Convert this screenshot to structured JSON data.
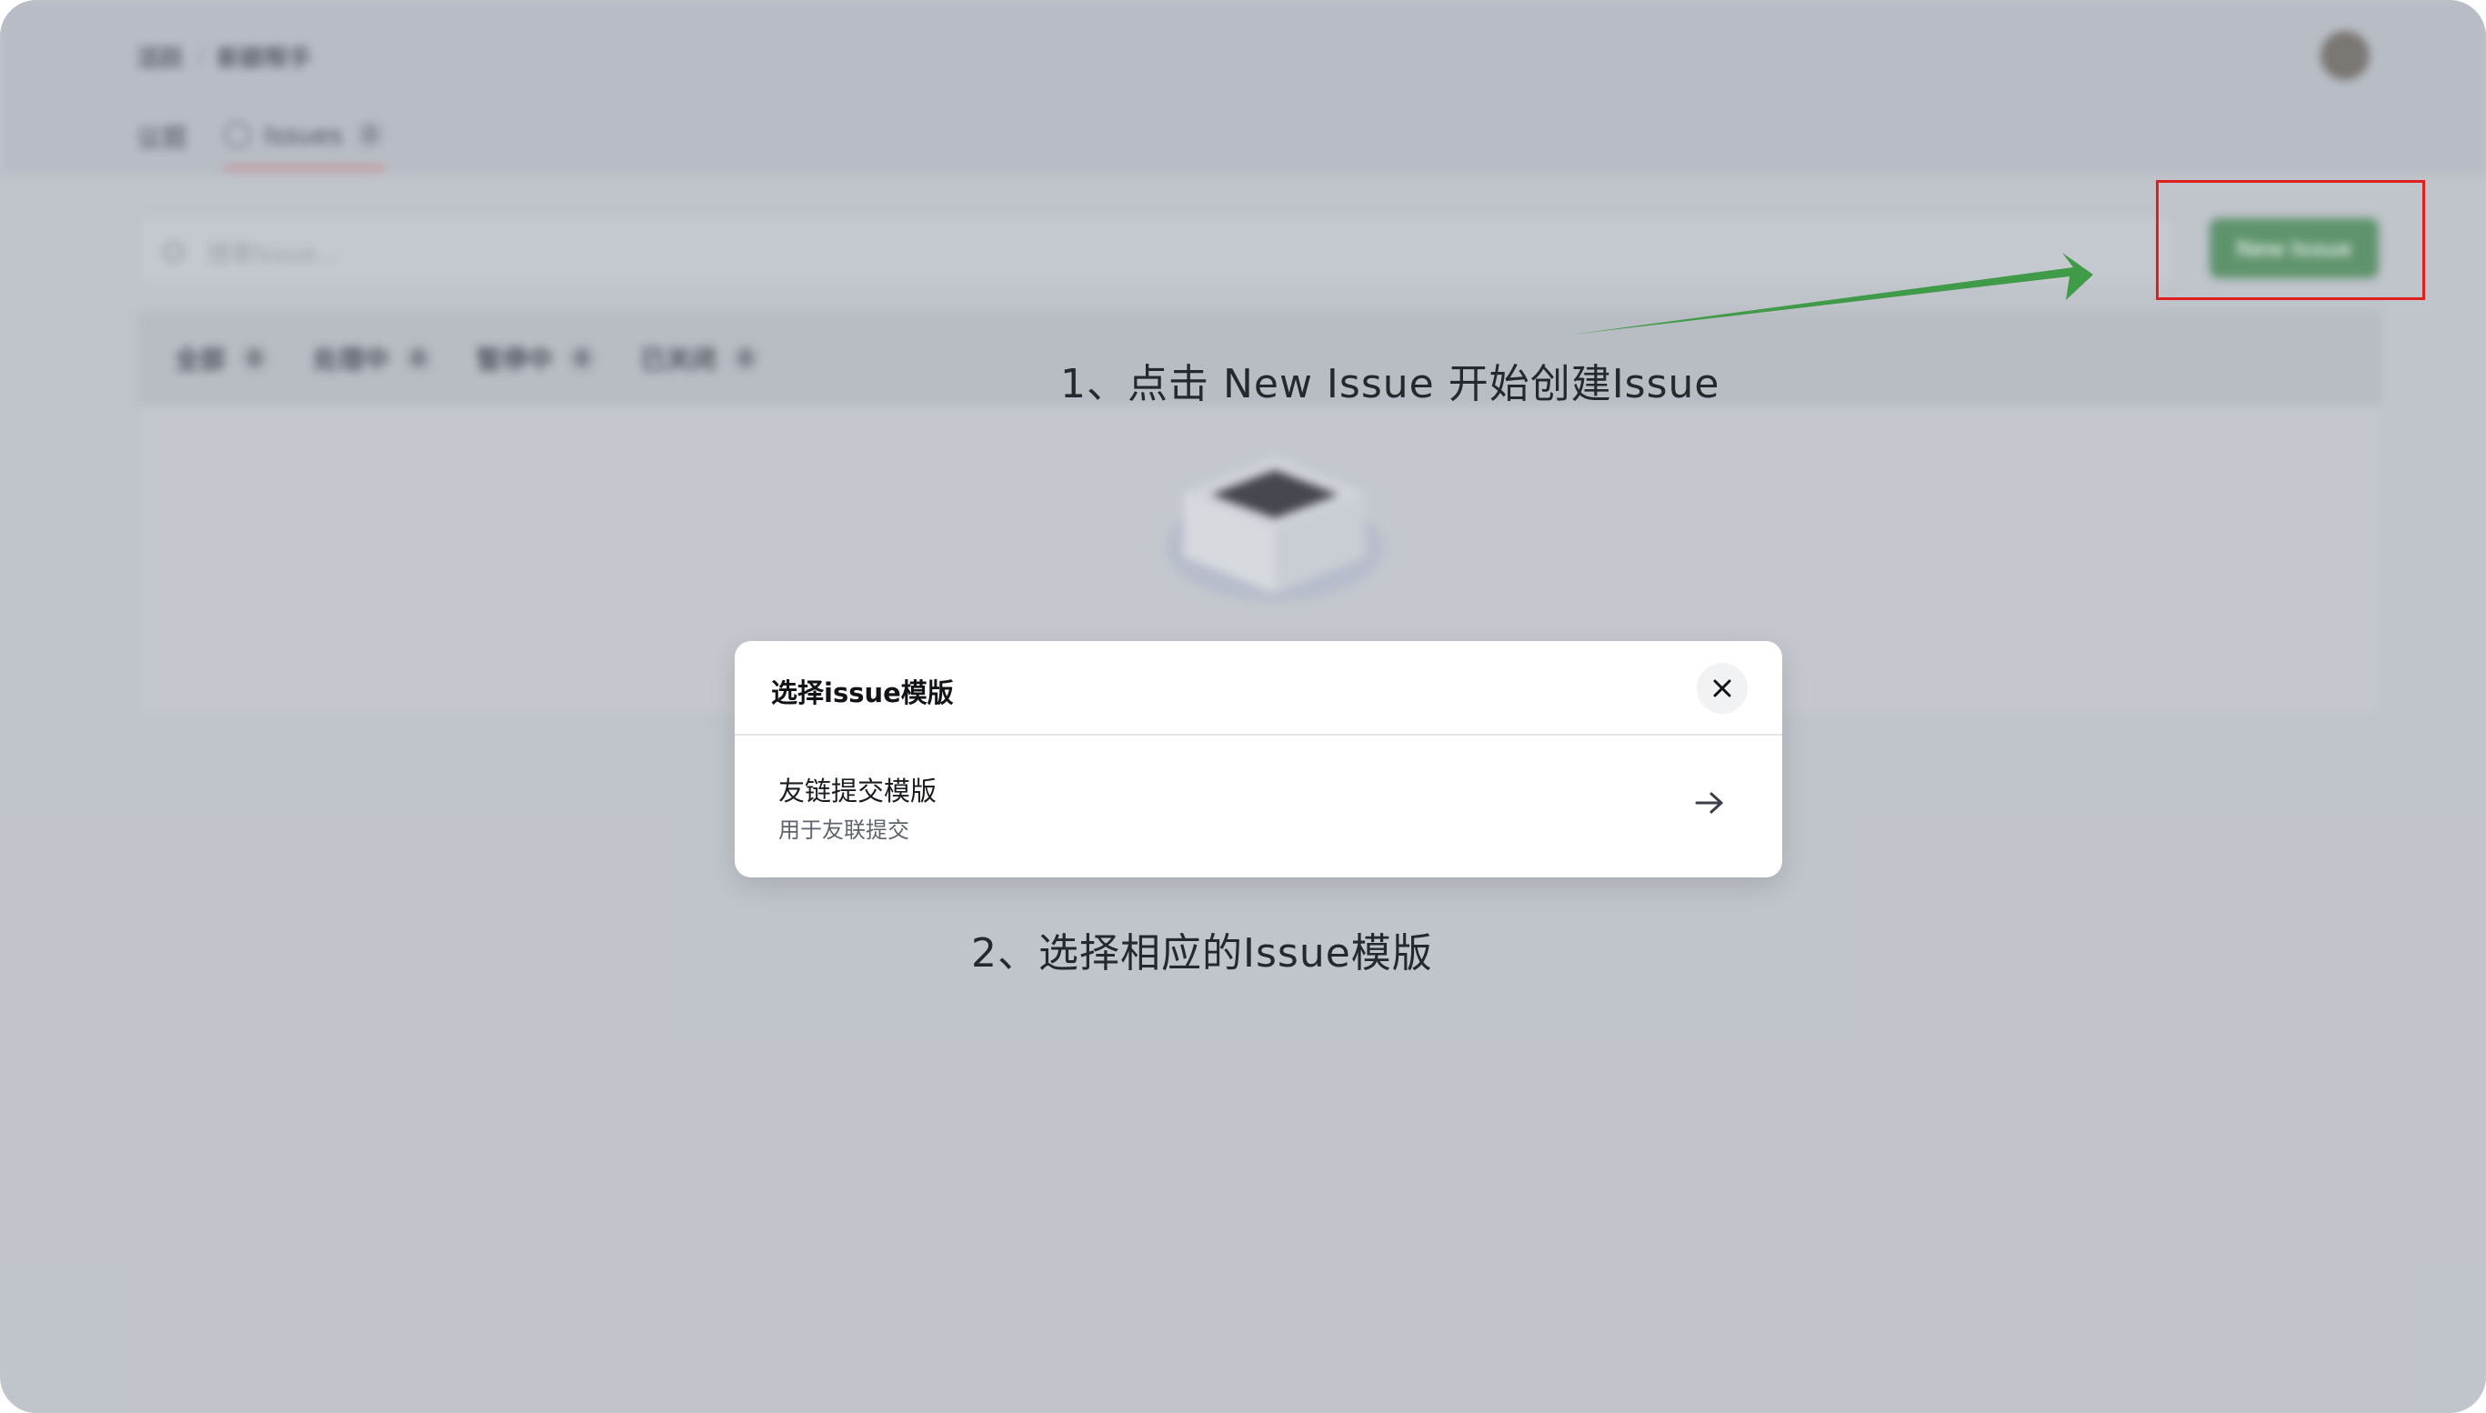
{
  "background_page": {
    "breadcrumb": [
      "活跃",
      "/",
      "新颖帮手"
    ],
    "tabs": [
      {
        "label": "议题"
      },
      {
        "label": "Issues",
        "count": "0"
      }
    ],
    "search_placeholder": "搜索Issue...",
    "new_issue_button": "New Issue",
    "filters": [
      {
        "label": "全部",
        "count": "0"
      },
      {
        "label": "处理中",
        "count": "0"
      },
      {
        "label": "暂停中",
        "count": "0"
      },
      {
        "label": "已关闭",
        "count": "0"
      }
    ]
  },
  "modal": {
    "title": "选择issue模版",
    "templates": [
      {
        "name": "友链提交模版",
        "description": "用于友联提交"
      }
    ]
  },
  "annotations": {
    "step1": "1、点击 New Issue 开始创建Issue",
    "step2": "2、选择相应的Issue模版",
    "highlight_color": "#e02020",
    "arrow_color": "#3f9b48"
  },
  "colors": {
    "primary_button": "#4c8c5a"
  }
}
